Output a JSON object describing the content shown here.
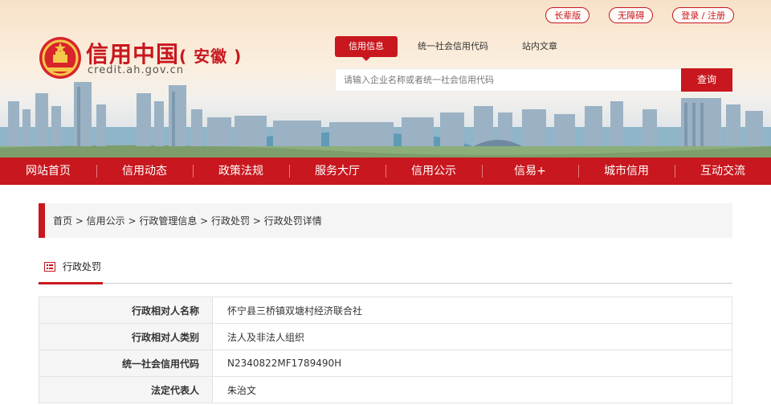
{
  "top_links": [
    "长辈版",
    "无障碍",
    "登录 / 注册"
  ],
  "logo": {
    "title": "信用中国",
    "region": "( 安徽 )",
    "domain": "credit.ah.gov.cn"
  },
  "search": {
    "tabs": [
      "信用信息",
      "统一社会信用代码",
      "站内文章"
    ],
    "placeholder": "请输入企业名称或者统一社会信用代码",
    "button": "查询"
  },
  "nav": [
    "网站首页",
    "信用动态",
    "政策法规",
    "服务大厅",
    "信用公示",
    "信易+",
    "城市信用",
    "互动交流"
  ],
  "breadcrumb": "首页 > 信用公示 >  行政管理信息 >  行政处罚 > 行政处罚详情",
  "section_title": "行政处罚",
  "details": [
    {
      "label": "行政相对人名称",
      "value": "怀宁县三桥镇双塘村经济联合社"
    },
    {
      "label": "行政相对人类别",
      "value": "法人及非法人组织"
    },
    {
      "label": "统一社会信用代码",
      "value": "N2340822MF1789490H"
    },
    {
      "label": "法定代表人",
      "value": "朱治文"
    }
  ],
  "colors": {
    "brand_red": "#c8171e",
    "label_bg": "#f5f5f5",
    "border": "#e2e2e2"
  }
}
